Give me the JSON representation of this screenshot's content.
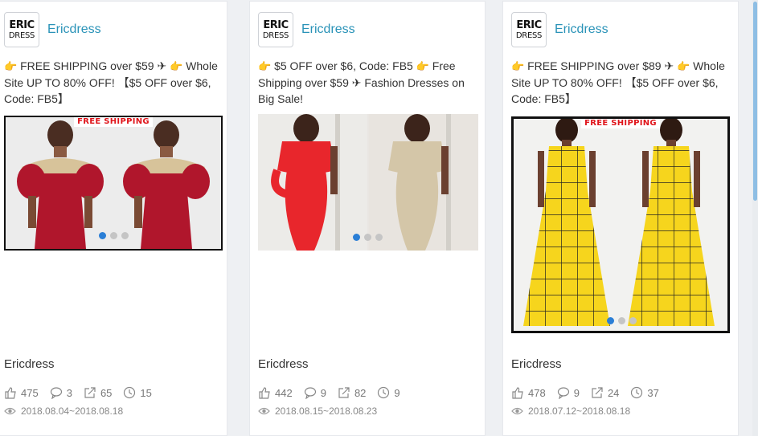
{
  "cards": [
    {
      "brand_logo_top": "ERIC",
      "brand_logo_bottom": "DRESS",
      "brand_name": "Ericdress",
      "promo_parts": [
        "FREE SHIPPING over $59 ✈",
        "Whole Site UP TO 80% OFF! 【$5 OFF over $6, Code: FB5】"
      ],
      "image_banner": "FREE SHIPPING",
      "dress_color": "#b0162c",
      "bottom_name": "Ericdress",
      "likes": "475",
      "comments": "3",
      "shares": "65",
      "time": "15",
      "date_range": "2018.08.04~2018.08.18"
    },
    {
      "brand_logo_top": "ERIC",
      "brand_logo_bottom": "DRESS",
      "brand_name": "Ericdress",
      "promo_parts": [
        "$5 OFF over $6, Code: FB5",
        "Free Shipping over $59 ✈ Fashion Dresses on Big Sale!"
      ],
      "image_banner": "",
      "dress_color": "#e8262c",
      "bottom_name": "Ericdress",
      "likes": "442",
      "comments": "9",
      "shares": "82",
      "time": "9",
      "date_range": "2018.08.15~2018.08.23"
    },
    {
      "brand_logo_top": "ERIC",
      "brand_logo_bottom": "DRESS",
      "brand_name": "Ericdress",
      "promo_parts": [
        "FREE SHIPPING over $89 ✈",
        "Whole Site UP TO 80% OFF! 【$5 OFF over $6, Code: FB5】"
      ],
      "image_banner": "FREE SHIPPING",
      "dress_color": "#f6d51d",
      "bottom_name": "Ericdress",
      "likes": "478",
      "comments": "9",
      "shares": "24",
      "time": "37",
      "date_range": "2018.07.12~2018.08.18"
    }
  ],
  "icons": {
    "promo": "pointing-hand-icon",
    "likes": "thumbs-up-icon",
    "comments": "comment-icon",
    "shares": "share-icon",
    "time": "clock-icon",
    "views": "eye-icon"
  },
  "colors": {
    "brand_link": "#2a93b8",
    "banner_red": "#e0151b",
    "carousel_active": "#2b7fd6"
  }
}
